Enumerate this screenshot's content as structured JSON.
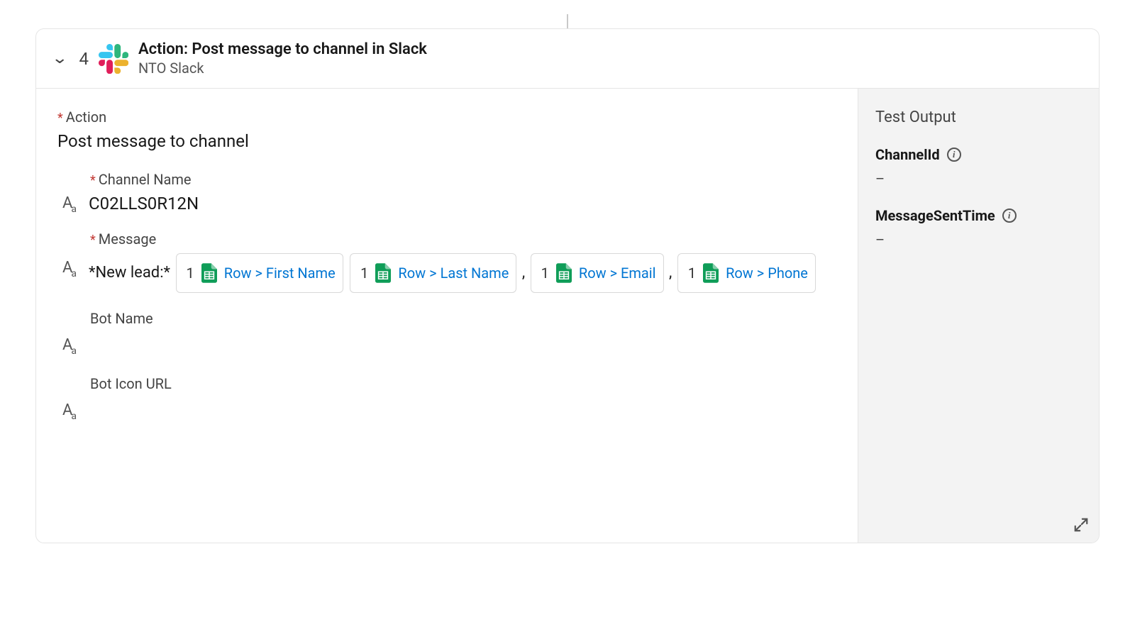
{
  "header": {
    "step": "4",
    "title": "Action: Post message to channel in Slack",
    "subtitle": "NTO Slack"
  },
  "form": {
    "actionLabel": "Action",
    "actionValue": "Post message to channel",
    "channelLabel": "Channel Name",
    "channelValue": "C02LLS0R12N",
    "messageLabel": "Message",
    "messagePrefix": "*New lead:*",
    "pills": [
      {
        "num": "1",
        "label": "Row > First Name"
      },
      {
        "num": "1",
        "label": "Row > Last Name"
      },
      {
        "num": "1",
        "label": "Row > Email"
      },
      {
        "num": "1",
        "label": "Row > Phone"
      }
    ],
    "sep1": ",",
    "sep2": ",",
    "sep3": ",",
    "botNameLabel": "Bot Name",
    "botIconLabel": "Bot Icon URL"
  },
  "output": {
    "title": "Test Output",
    "fields": [
      {
        "label": "ChannelId",
        "value": "–"
      },
      {
        "label": "MessageSentTime",
        "value": "–"
      }
    ]
  }
}
